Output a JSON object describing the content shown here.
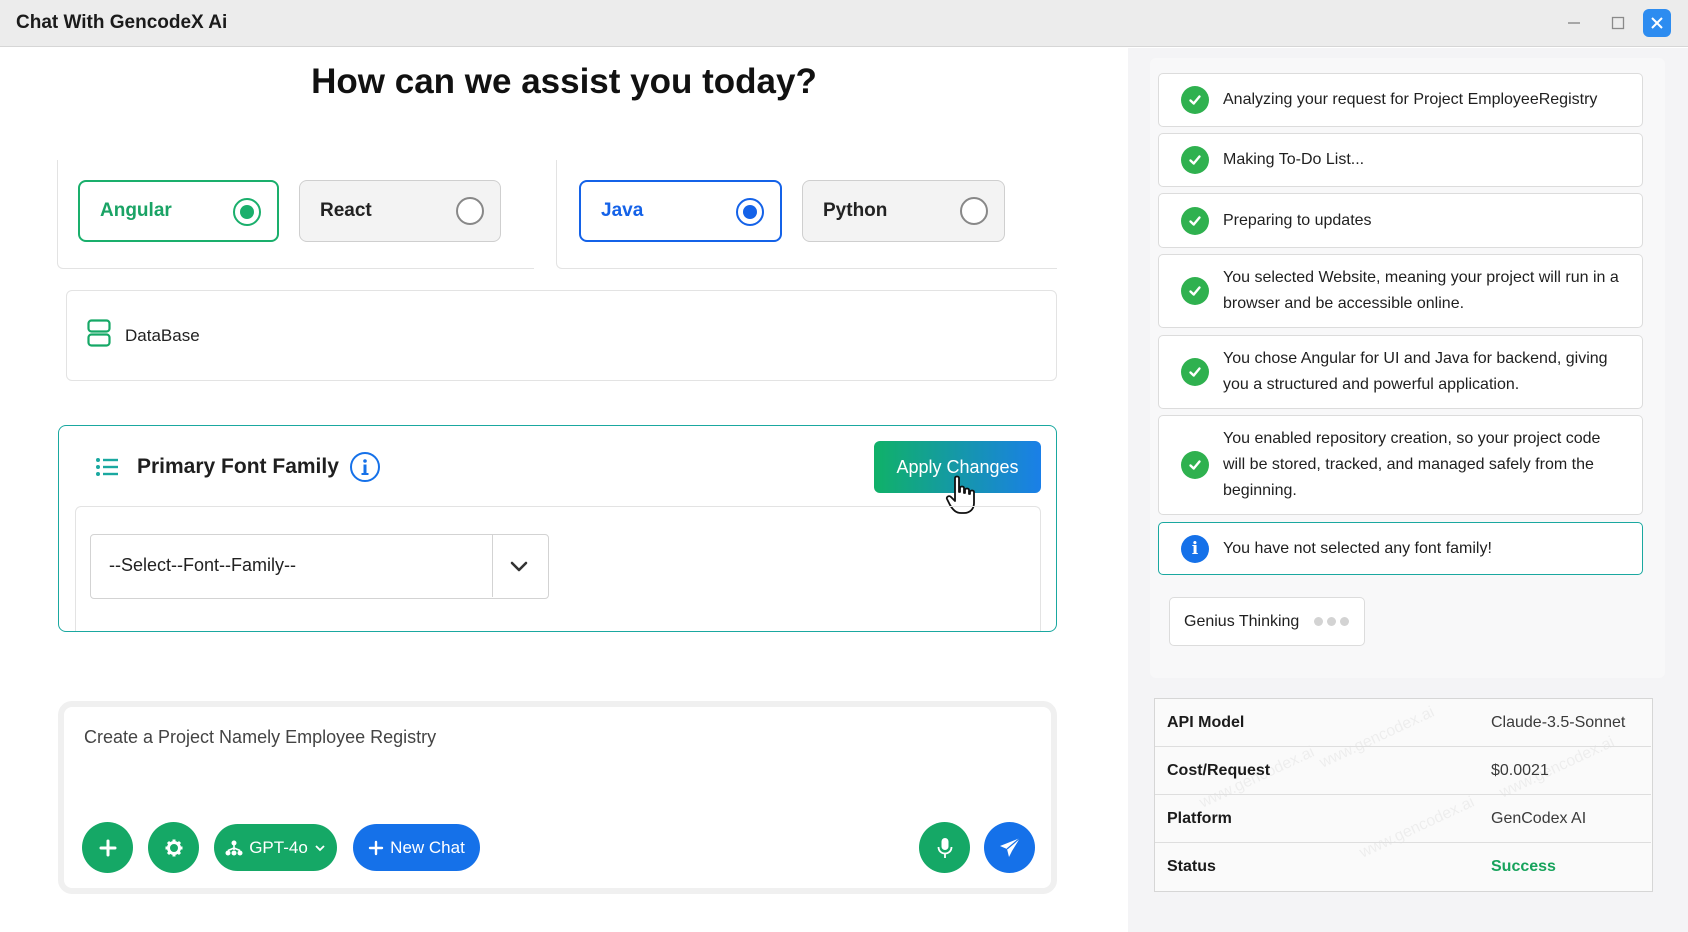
{
  "window": {
    "title": "Chat With GencodeX Ai",
    "controls": [
      "minimize-icon",
      "maximize-icon",
      "close-icon"
    ]
  },
  "main": {
    "heading": "How can we assist you today?",
    "frontend_options": [
      {
        "label": "Angular",
        "selected": true
      },
      {
        "label": "React",
        "selected": false
      }
    ],
    "backend_options": [
      {
        "label": "Java",
        "selected": true
      },
      {
        "label": "Python",
        "selected": false
      }
    ],
    "database": {
      "label": "DataBase",
      "icon": "database-icon"
    },
    "font_panel": {
      "title": "Primary Font Family",
      "apply_label": "Apply Changes",
      "select_value": "--Select--Font--Family--"
    },
    "chat": {
      "prompt": "Create a Project Namely Employee Registry",
      "model_label": "GPT-4o",
      "new_chat_label": "New Chat"
    }
  },
  "sidebar": {
    "steps": [
      {
        "text": "Analyzing your request for Project EmployeeRegistry",
        "status": "done"
      },
      {
        "text": "Making To-Do List...",
        "status": "done"
      },
      {
        "text": "Preparing to updates",
        "status": "done"
      },
      {
        "text": "You selected Website, meaning your project will run in a browser and be accessible online.",
        "status": "done"
      },
      {
        "text": "You chose Angular for UI and Java for backend, giving you a structured and powerful application.",
        "status": "done"
      },
      {
        "text": "You enabled repository creation, so your project code will be stored, tracked, and managed safely from the beginning.",
        "status": "done"
      },
      {
        "text": "You have not selected any font family!",
        "status": "info"
      }
    ],
    "thinking_label": "Genius Thinking",
    "info_table": [
      {
        "key": "API Model",
        "value": "Claude-3.5-Sonnet"
      },
      {
        "key": "Cost/Request",
        "value": "$0.0021"
      },
      {
        "key": "Platform",
        "value": "GenCodex AI"
      },
      {
        "key": "Status",
        "value": "Success"
      }
    ],
    "watermark": "www.gencodex.ai"
  },
  "colors": {
    "green": "#15a866",
    "blue": "#1571e9",
    "success": "#17a35c",
    "panel_border": "#1aa8a0"
  }
}
